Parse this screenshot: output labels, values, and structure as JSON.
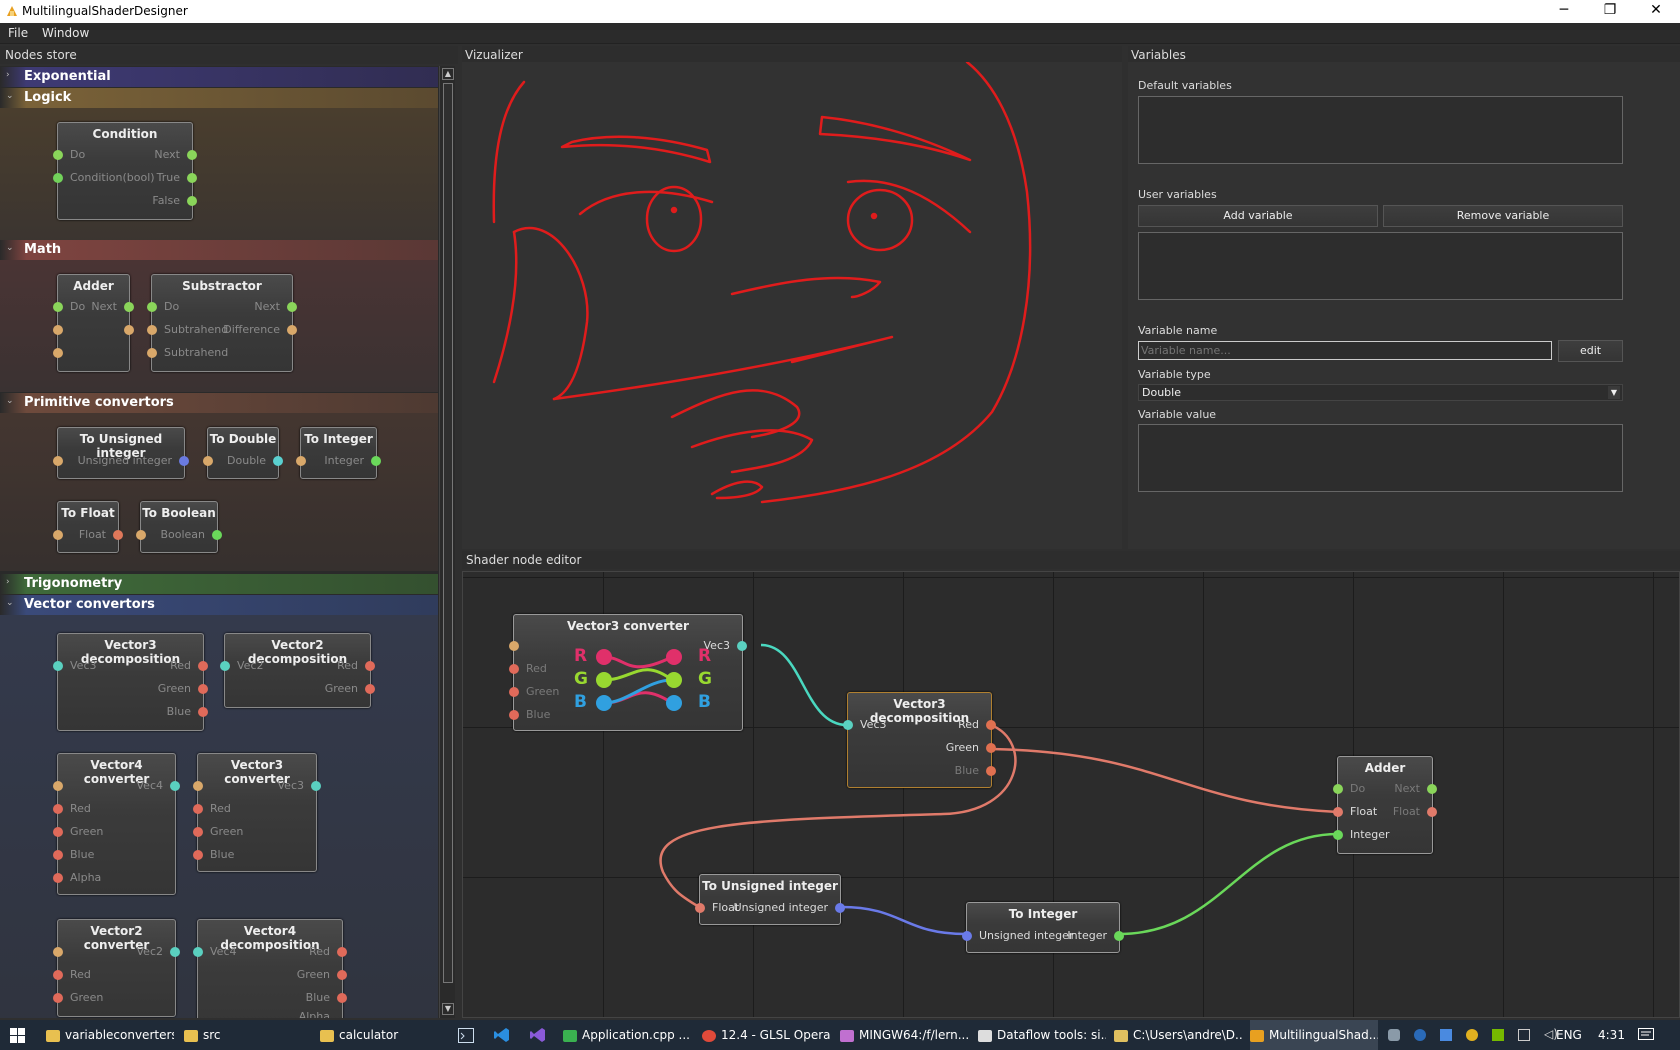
{
  "window": {
    "title": "MultilingualShaderDesigner",
    "minimize": "─",
    "maximize": "❐",
    "close": "✕"
  },
  "menu": [
    "File",
    "Window"
  ],
  "docks": {
    "nodes_store": "Nodes store",
    "visualizer": "Vizualizer",
    "variables": "Variables",
    "editor": "Shader node editor"
  },
  "categories": {
    "exponential": "Exponential",
    "logick": "Logick",
    "math": "Math",
    "primitive": "Primitive convertors",
    "trigonometry": "Trigonometry",
    "vector": "Vector convertors"
  },
  "store_nodes": {
    "condition": {
      "title": "Condition",
      "do": "Do",
      "next": "Next",
      "cond": "Condition(bool)",
      "true": "True",
      "false": "False"
    },
    "adder": {
      "title": "Adder",
      "do": "Do",
      "next": "Next"
    },
    "substractor": {
      "title": "Substractor",
      "do": "Do",
      "next": "Next",
      "sub1": "Subtrahend",
      "diff": "Difference",
      "sub2": "Subtrahend"
    },
    "to_uint": {
      "title": "To Unsigned integer",
      "out": "Unsigned integer"
    },
    "to_double": {
      "title": "To Double",
      "out": "Double"
    },
    "to_int": {
      "title": "To Integer",
      "out": "Integer"
    },
    "to_float": {
      "title": "To Float",
      "out": "Float"
    },
    "to_bool": {
      "title": "To Boolean",
      "out": "Boolean"
    },
    "v3dec": {
      "title": "Vector3 decomposition",
      "in": "Vec3",
      "red": "Red",
      "green": "Green",
      "blue": "Blue"
    },
    "v2dec": {
      "title": "Vector2 decomposition",
      "in": "Vec2",
      "red": "Red",
      "green": "Green"
    },
    "v4conv": {
      "title": "Vector4 converter",
      "out": "Vec4",
      "red": "Red",
      "green": "Green",
      "blue": "Blue",
      "alpha": "Alpha"
    },
    "v3conv": {
      "title": "Vector3 converter",
      "out": "Vec3",
      "red": "Red",
      "green": "Green",
      "blue": "Blue"
    },
    "v2conv": {
      "title": "Vector2 converter",
      "out": "Vec2",
      "red": "Red",
      "green": "Green"
    },
    "v4dec": {
      "title": "Vector4 decomposition",
      "in": "Vec4",
      "red": "Red",
      "green": "Green",
      "blue": "Blue",
      "alpha": "Alpha"
    }
  },
  "variables": {
    "default_label": "Default variables",
    "user_label": "User variables",
    "add": "Add variable",
    "remove": "Remove variable",
    "name_label": "Variable name",
    "name_placeholder": "Variable name...",
    "edit": "edit",
    "type_label": "Variable type",
    "type_value": "Double",
    "value_label": "Variable value"
  },
  "editor_nodes": {
    "v3conv": {
      "title": "Vector3 converter",
      "out": "Vec3",
      "red": "Red",
      "green": "Green",
      "blue": "Blue",
      "r": "R",
      "g": "G",
      "b": "B"
    },
    "v3dec": {
      "title": "Vector3 decomposition",
      "in": "Vec3",
      "red": "Red",
      "green": "Green",
      "blue": "Blue"
    },
    "adder": {
      "title": "Adder",
      "do": "Do",
      "next": "Next",
      "float": "Float",
      "float_out": "Float",
      "integer": "Integer"
    },
    "to_uint": {
      "title": "To Unsigned integer",
      "in": "Float",
      "out": "Unsigned integer"
    },
    "to_int": {
      "title": "To Integer",
      "in": "Unsigned integer",
      "out": "Integer"
    }
  },
  "taskbar": {
    "items": [
      "variableconverters",
      "src",
      "calculator",
      "Application.cpp ...",
      "12.4 - GLSL Opera...",
      "MINGW64:/f/lern...",
      "Dataflow tools: si...",
      "C:\\Users\\andre\\D...",
      "MultilingualShad..."
    ],
    "lang": "ENG",
    "time": "4:31"
  }
}
